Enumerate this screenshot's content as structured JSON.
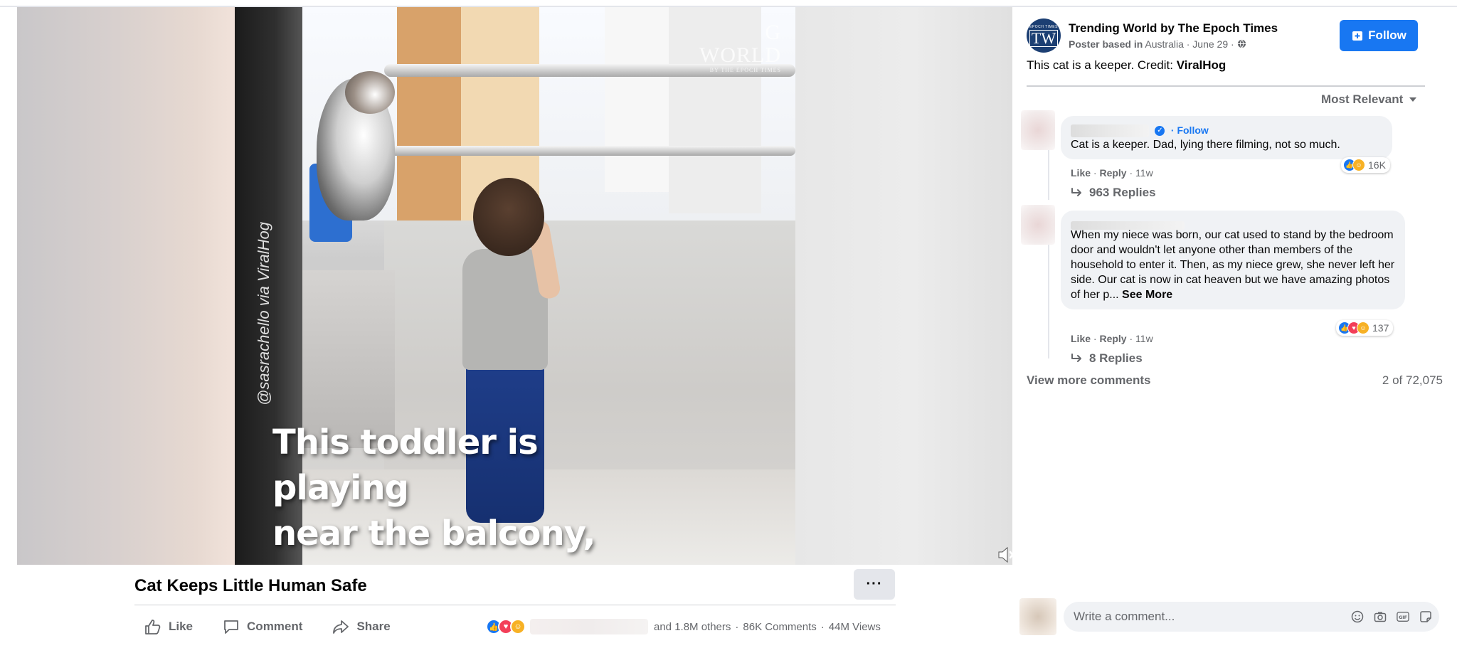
{
  "video": {
    "watermark_line1": "G",
    "watermark_line2": "WORLD",
    "watermark_sub": "BY THE EPOCH TIMES",
    "credit_vertical": "@sasrachello via ViralHog",
    "caption_line1": "This toddler is playing",
    "caption_line2": "near the balcony,",
    "mute_icon": "speaker-muted-icon"
  },
  "post": {
    "title": "Cat Keeps Little Human Safe",
    "more_label": "···",
    "actions": {
      "like": "Like",
      "comment": "Comment",
      "share": "Share"
    },
    "reaction_summary": "and 1.8M others",
    "comments_count": "86K Comments",
    "views_count": "44M Views",
    "separator": "·"
  },
  "page": {
    "logo_top": "EPOCH TIMES",
    "logo_letters": "TW",
    "name": "Trending World by The Epoch Times",
    "meta_prefix": "Poster based in",
    "meta_location": "Australia",
    "meta_date": "· June 29 ·",
    "follow_label": "Follow",
    "post_text": "This cat is a keeper. Credit: ",
    "post_credit": "ViralHog"
  },
  "comments": {
    "sort_label": "Most Relevant",
    "items": [
      {
        "follow_label": "· Follow",
        "text": "Cat is a keeper. Dad, lying there filming, not so much.",
        "like": "Like",
        "reply": "Reply",
        "time": "· 11w",
        "reactions_count": "16K",
        "replies_label": "963 Replies"
      },
      {
        "text": "When my niece was born, our cat used to stand by the bedroom door and wouldn't let anyone other than members of the household to enter it. Then, as my niece grew, she never left her side. Our cat is now in cat heaven but we have amazing photos of her p...",
        "see_more": "See More",
        "like": "Like",
        "reply": "Reply",
        "time": "· 11w",
        "reactions_count": "137",
        "replies_label": "8 Replies"
      }
    ],
    "view_more": "View more comments",
    "count_label": "2 of 72,075"
  },
  "composer": {
    "placeholder": "Write a comment...",
    "icons": [
      "emoji-icon",
      "camera-icon",
      "gif-icon",
      "sticker-icon"
    ]
  },
  "colors": {
    "accent": "#1877f2",
    "secondary_text": "#65676b",
    "bubble_bg": "#f0f2f5"
  }
}
